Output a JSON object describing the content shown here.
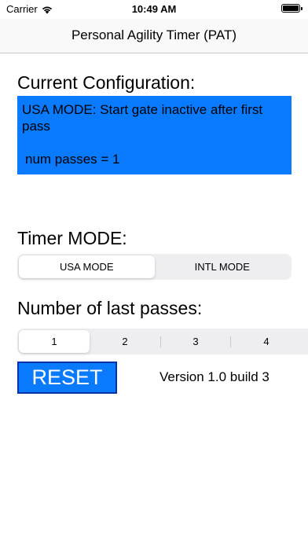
{
  "status": {
    "carrier": "Carrier",
    "time": "10:49 AM",
    "wifi_icon": "wifi-icon",
    "battery_icon": "battery-icon"
  },
  "nav": {
    "title": "Personal Agility Timer (PAT)"
  },
  "config": {
    "label": "Current Configuration:",
    "line1": "USA MODE: Start gate inactive after first pass",
    "line2": "num passes = 1",
    "box_color": "#0a7aff"
  },
  "timer_mode": {
    "label": "Timer MODE:",
    "options": [
      "USA MODE",
      "INTL MODE"
    ],
    "selected": "USA MODE"
  },
  "last_passes": {
    "label": "Number of last passes:",
    "options": [
      "1",
      "2",
      "3",
      "4"
    ],
    "selected": "1"
  },
  "reset_label": "RESET",
  "version": "Version 1.0 build 3",
  "colors": {
    "accent": "#0a7aff",
    "reset_border": "#0033aa"
  }
}
